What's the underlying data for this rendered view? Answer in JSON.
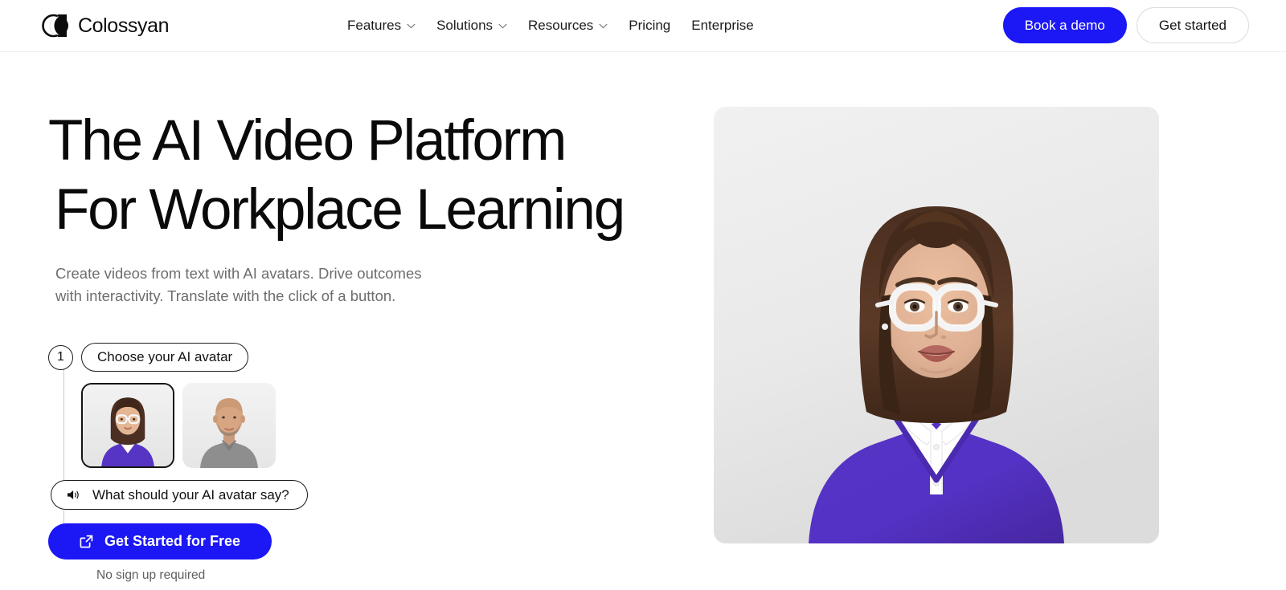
{
  "brand": {
    "name": "Colossyan",
    "logo_icon": "colossyan-circles-logo"
  },
  "nav": {
    "items": [
      {
        "label": "Features",
        "has_dropdown": true,
        "icon": "chevron-down-icon"
      },
      {
        "label": "Solutions",
        "has_dropdown": true,
        "icon": "chevron-down-icon"
      },
      {
        "label": "Resources",
        "has_dropdown": true,
        "icon": "chevron-down-icon"
      },
      {
        "label": "Pricing",
        "has_dropdown": false,
        "icon": ""
      },
      {
        "label": "Enterprise",
        "has_dropdown": false,
        "icon": ""
      }
    ]
  },
  "header_actions": {
    "demo_label": "Book a demo",
    "get_started_label": "Get started"
  },
  "hero": {
    "title_line1": "The AI Video Platform",
    "title_line2": "For Workplace Learning",
    "subtitle": "Create videos from text with AI avatars. Drive outcomes with interactivity. Translate with the click of a button.",
    "image_alt": "woman-with-white-glasses-purple-sweater-avatar"
  },
  "widget": {
    "step_number": "1",
    "step_label": "Choose your AI avatar",
    "avatars": [
      {
        "name": "avatar-thumb-woman-glasses",
        "selected": true
      },
      {
        "name": "avatar-thumb-man-gray-shirt",
        "selected": false
      }
    ],
    "say_icon": "speaker-icon",
    "say_prompt": "What should your AI avatar say?",
    "cta_icon": "external-link-icon",
    "cta_label": "Get Started for Free",
    "note": "No sign up required"
  },
  "colors": {
    "accent_blue": "#1b17f5",
    "sweater_purple": "#5634c4",
    "text_dark": "#0a0a0a",
    "text_muted": "#6d6d6d",
    "border_light": "#ececec"
  }
}
